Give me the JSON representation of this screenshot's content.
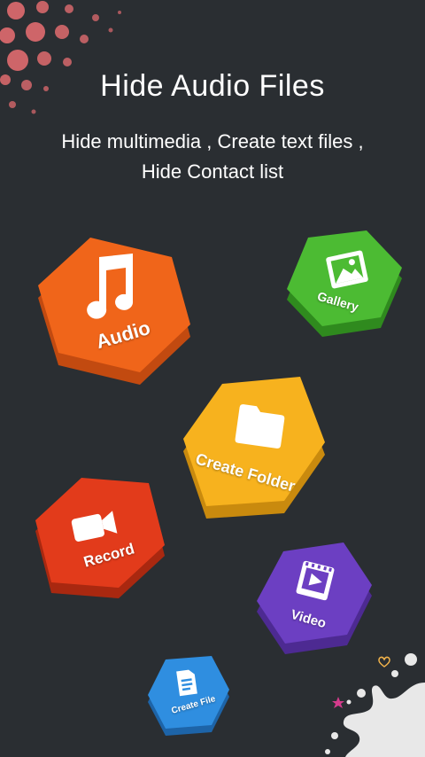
{
  "header": {
    "title": "Hide Audio Files",
    "subtitle_line1": "Hide multimedia , Create text files ,",
    "subtitle_line2": "Hide Contact list"
  },
  "tiles": {
    "audio": {
      "label": "Audio",
      "color": "#f0651a",
      "shade": "#c24a10"
    },
    "gallery": {
      "label": "Gallery",
      "color": "#4cbb33",
      "shade": "#2f8a1e"
    },
    "create_folder": {
      "label": "Create Folder",
      "color": "#f7b21e",
      "shade": "#c98a0e"
    },
    "record": {
      "label": "Record",
      "color": "#e23b1b",
      "shade": "#a92810"
    },
    "video": {
      "label": "Video",
      "color": "#6c3fc2",
      "shade": "#4d2a92"
    },
    "create_file": {
      "label": "Create File",
      "color": "#2f8ee0",
      "shade": "#1d64a8"
    }
  },
  "icons": {
    "audio": "music-note-icon",
    "gallery": "image-icon",
    "create_folder": "folder-icon",
    "record": "video-camera-icon",
    "video": "film-play-icon",
    "create_file": "document-icon"
  }
}
